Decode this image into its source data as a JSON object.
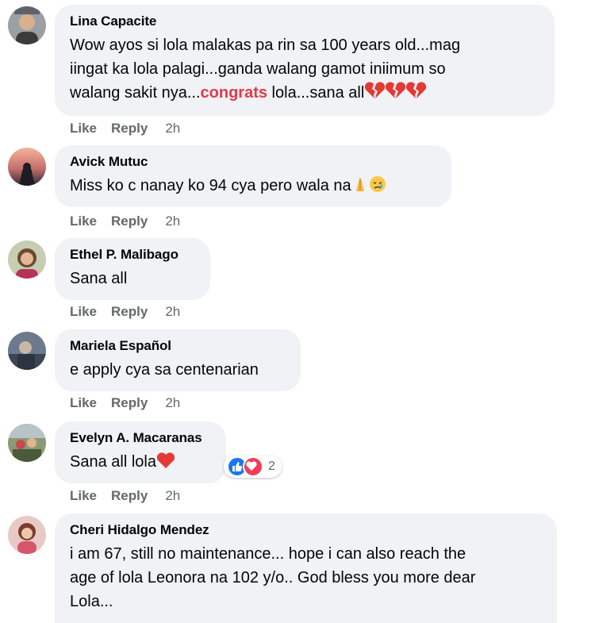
{
  "comments": [
    {
      "name": "Lina Capacite",
      "text_lines": [
        "Wow ayos si lola malakas pa rin sa 100 years old...mag",
        "iingat ka lola palagi...ganda walang gamot iniimum so"
      ],
      "line3_before": "walang sakit nya...",
      "line3_highlight": "congrats",
      "line3_after": " lola...sana all",
      "emoji": "broken-heart x3",
      "like": "Like",
      "reply": "Reply",
      "time": "2h"
    },
    {
      "name": "Avick Mutuc",
      "text": "Miss ko c nanay ko 94 cya pero wala na",
      "emoji": "folded-hands, sad-face",
      "like": "Like",
      "reply": "Reply",
      "time": "2h"
    },
    {
      "name": "Ethel P. Malibago",
      "text": "Sana all",
      "like": "Like",
      "reply": "Reply",
      "time": "2h"
    },
    {
      "name": "Mariela Español",
      "text": "e apply cya sa centenarian",
      "like": "Like",
      "reply": "Reply",
      "time": "2h"
    },
    {
      "name": "Evelyn A. Macaranas",
      "text": "Sana all lola",
      "emoji": "red-heart",
      "reaction_count": "2",
      "like": "Like",
      "reply": "Reply",
      "time": "2h"
    },
    {
      "name": "Cheri Hidalgo Mendez",
      "text_lines": [
        "i am 67, still no maintenance... hope i can also reach the",
        "age of lola Leonora na 102 y/o.. God bless you more dear",
        "Lola..."
      ]
    }
  ],
  "colors": {
    "bubble": "#f0f2f5",
    "action_text": "#65676b",
    "highlight": "#e4384b",
    "like_blue": "#1877f2",
    "love_red": "#f33e58"
  }
}
